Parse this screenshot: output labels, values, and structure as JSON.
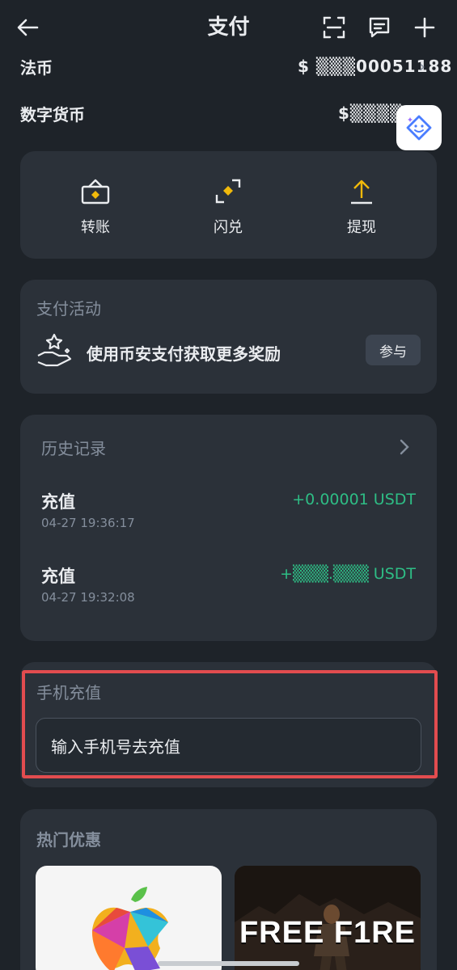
{
  "header": {
    "title": "支付",
    "back_icon": "back-arrow-icon",
    "scan_icon": "scan-icon",
    "message_icon": "message-icon",
    "add_icon": "plus-icon"
  },
  "balances": {
    "fiat_label": "法币",
    "fiat_value": "$ ▒▒▒00051188",
    "crypto_label": "数字货币",
    "crypto_value": "$▒▒▒▒.4"
  },
  "actions": [
    {
      "label": "转账",
      "icon": "transfer-icon"
    },
    {
      "label": "闪兑",
      "icon": "convert-icon"
    },
    {
      "label": "提现",
      "icon": "withdraw-icon"
    }
  ],
  "promo_activity": {
    "title": "支付活动",
    "text": "使用币安支付获取更多奖励",
    "button": "参与"
  },
  "history": {
    "title": "历史记录",
    "items": [
      {
        "type": "充值",
        "time": "04-27 19:36:17",
        "amount": "+0.00001 USDT"
      },
      {
        "type": "充值",
        "time": "04-27 19:32:08",
        "amount": "+▒▒▒.▒▒▒ USDT"
      }
    ]
  },
  "mobile_topup": {
    "title": "手机充值",
    "placeholder": "输入手机号去充值"
  },
  "hot_deals": {
    "title": "热门优惠",
    "items": [
      {
        "name": "apple-gift-card"
      },
      {
        "name": "free-fire",
        "text": "FREE F1RE"
      }
    ]
  },
  "colors": {
    "background": "#1e2329",
    "card": "#2b3139",
    "accent": "#f0b90b",
    "positive": "#2ebd85",
    "highlight": "#e24c4f"
  }
}
